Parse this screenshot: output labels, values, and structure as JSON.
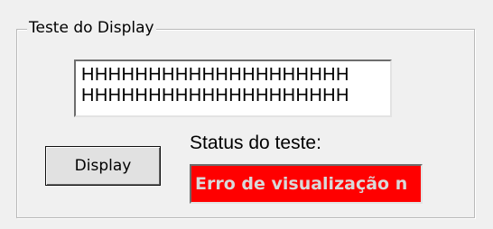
{
  "group": {
    "title": "Teste do Display"
  },
  "display": {
    "line1": "HHHHHHHHHHHHHHHHHHHH",
    "line2": "HHHHHHHHHHHHHHHHHHHH"
  },
  "button": {
    "label": "Display"
  },
  "status": {
    "label": "Status do teste:",
    "value": "Erro de visualização n",
    "background_color": "#ff0000",
    "text_color": "#d9d9d9"
  }
}
